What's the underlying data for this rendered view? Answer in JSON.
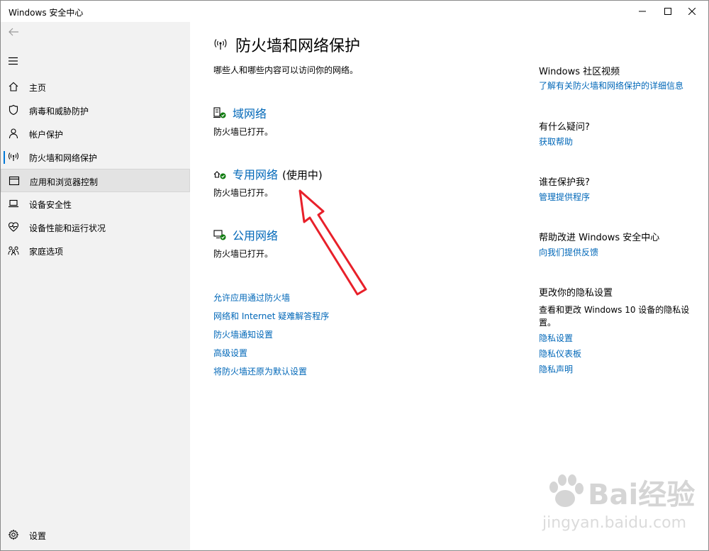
{
  "window": {
    "title": "Windows 安全中心"
  },
  "sidebar": {
    "items": [
      {
        "label": "主页",
        "icon": "home-icon"
      },
      {
        "label": "病毒和威胁防护",
        "icon": "shield-icon"
      },
      {
        "label": "帐户保护",
        "icon": "person-icon"
      },
      {
        "label": "防火墙和网络保护",
        "icon": "wireless-icon",
        "selected": true
      },
      {
        "label": "应用和浏览器控制",
        "icon": "browser-window-icon",
        "hover": true
      },
      {
        "label": "设备安全性",
        "icon": "laptop-icon"
      },
      {
        "label": "设备性能和运行状况",
        "icon": "heart-pulse-icon"
      },
      {
        "label": "家庭选项",
        "icon": "family-icon"
      }
    ],
    "settings_label": "设置"
  },
  "main": {
    "title": "防火墙和网络保护",
    "subtitle": "哪些人和哪些内容可以访问你的网络。",
    "networks": [
      {
        "name": "域网络",
        "in_use": "",
        "status": "防火墙已打开。",
        "icon": "domain-network-icon"
      },
      {
        "name": "专用网络",
        "in_use": "(使用中)",
        "status": "防火墙已打开。",
        "icon": "private-network-icon"
      },
      {
        "name": "公用网络",
        "in_use": "",
        "status": "防火墙已打开。",
        "icon": "public-network-icon"
      }
    ],
    "links": [
      "允许应用通过防火墙",
      "网络和 Internet 疑难解答程序",
      "防火墙通知设置",
      "高级设置",
      "将防火墙还原为默认设置"
    ]
  },
  "right": {
    "community_head": "Windows 社区视频",
    "community_link": "了解有关防火墙和网络保护的详细信息",
    "question_head": "有什么疑问?",
    "question_link": "获取帮助",
    "protect_head": "谁在保护我?",
    "protect_link": "管理提供程序",
    "improve_head": "帮助改进 Windows 安全中心",
    "improve_link": "向我们提供反馈",
    "privacy_head": "更改你的隐私设置",
    "privacy_text": "查看和更改 Windows 10 设备的隐私设置。",
    "privacy_links": [
      "隐私设置",
      "隐私仪表板",
      "隐私声明"
    ]
  },
  "watermark": {
    "brand": "Bai经验",
    "url": "jingyan.baidu.com"
  },
  "colors": {
    "accent": "#0078d7",
    "link": "#0067b8",
    "sidebar_bg": "#f2f2f2",
    "check_green": "#107c10",
    "annotation_red": "#e8202a"
  }
}
